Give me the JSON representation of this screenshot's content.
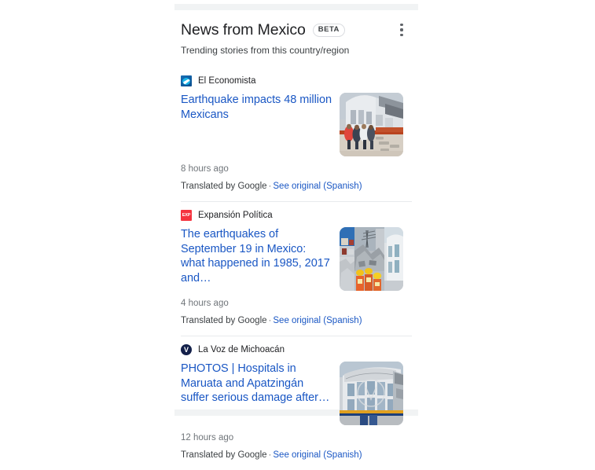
{
  "card": {
    "title": "News from Mexico",
    "badge": "BETA",
    "subtitle": "Trending stories from this country/region",
    "overflow_menu_label": "More options"
  },
  "articles": [
    {
      "source": "El Economista",
      "source_icon": "el-economista-favicon",
      "headline": "Earthquake impacts 48 million Mexicans",
      "time": "8 hours ago",
      "translation_note": "Translated by Google",
      "separator": "·",
      "original_link": "See original (Spanish)",
      "thumbnail_alt": "damaged-building-with-people-walking-over-rubble"
    },
    {
      "source": "Expansión Política",
      "source_icon": "expansion-politica-favicon",
      "headline": "The earthquakes of September 19 in Mexico: what happened in 1985, 2017 and…",
      "time": "4 hours ago",
      "translation_note": "Translated by Google",
      "separator": "·",
      "original_link": "See original (Spanish)",
      "thumbnail_alt": "collage-of-collapsed-buildings-and-rescue-workers"
    },
    {
      "source": "La Voz de Michoacán",
      "source_icon": "la-voz-de-michoacan-favicon",
      "headline": "PHOTOS | Hospitals in Maruata and Apatzingán suffer serious damage after…",
      "time": "12 hours ago",
      "translation_note": "Translated by Google",
      "separator": "·",
      "original_link": "See original (Spanish)",
      "thumbnail_alt": "damaged-hospital-building-facade"
    }
  ],
  "colors": {
    "link": "#1a57c4",
    "title": "#202124",
    "muted": "#70757a",
    "divider": "#e8eaed",
    "strip": "#f1f3f4"
  }
}
